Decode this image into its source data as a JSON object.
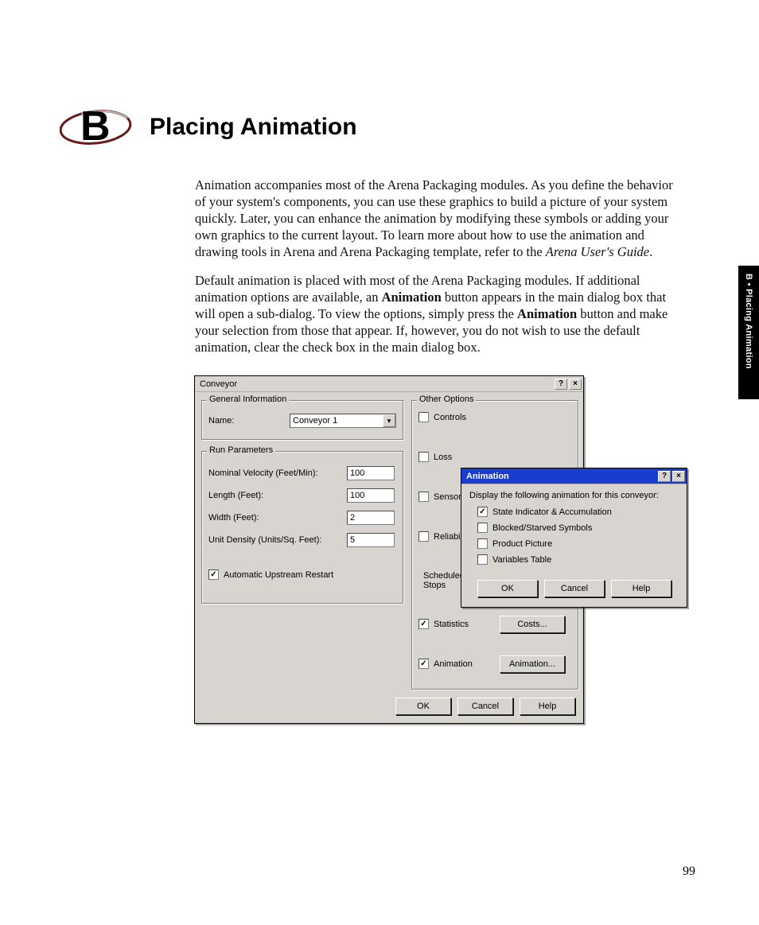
{
  "chapter": {
    "letter": "B",
    "title": "Placing Animation",
    "side_tab": "B • Placing Animation",
    "page_number": "99"
  },
  "paragraphs": {
    "p1_a": "Animation accompanies most of the Arena Packaging modules. As you define the behavior of your system's components, you can use these graphics to build a picture of your system quickly. Later, you can enhance the animation by modifying these symbols or adding your own graphics to the current layout. To learn more about how to use the animation and drawing tools in Arena and Arena Packaging template, refer to the ",
    "p1_italic": "Arena User's Guide",
    "p1_b": ".",
    "p2_a": "Default animation is placed with most of the Arena Packaging modules. If additional animation options are available, an ",
    "p2_bold1": "Animation",
    "p2_b": " button appears in the main dialog box that will open a sub-dialog. To view the options, simply press the ",
    "p2_bold2": "Animation",
    "p2_c": " button and make your selection from those that appear. If, however, you do not wish to use the default animation, clear the check box in the main dialog box."
  },
  "dialog_main": {
    "title": "Conveyor",
    "help_glyph": "?",
    "close_glyph": "×",
    "group_general": "General Information",
    "name_label": "Name:",
    "name_value": "Conveyor 1",
    "group_run": "Run Parameters",
    "nominal_velocity_label": "Nominal Velocity (Feet/Min):",
    "nominal_velocity_value": "100",
    "length_label": "Length (Feet):",
    "length_value": "100",
    "width_label": "Width (Feet):",
    "width_value": "2",
    "unit_density_label": "Unit Density (Units/Sq. Feet):",
    "unit_density_value": "5",
    "auto_restart_label": "Automatic Upstream Restart",
    "group_other": "Other Options",
    "opt_controls": "Controls",
    "opt_loss": "Loss",
    "opt_sensors": "Sensors",
    "opt_reliability": "Reliability",
    "opt_scheduled_stops_l1": "Scheduled",
    "opt_scheduled_stops_l2": "Stops",
    "opt_statistics": "Statistics",
    "opt_animation": "Animation",
    "btn_costs": "Costs...",
    "btn_animation": "Animation...",
    "btn_ok": "OK",
    "btn_cancel": "Cancel",
    "btn_help": "Help"
  },
  "dialog_anim": {
    "title": "Animation",
    "help_glyph": "?",
    "close_glyph": "×",
    "intro": "Display the following animation for this conveyor:",
    "opt_state": "State Indicator & Accumulation",
    "opt_blocked": "Blocked/Starved Symbols",
    "opt_product": "Product Picture",
    "opt_vars": "Variables Table",
    "btn_ok": "OK",
    "btn_cancel": "Cancel",
    "btn_help": "Help"
  }
}
